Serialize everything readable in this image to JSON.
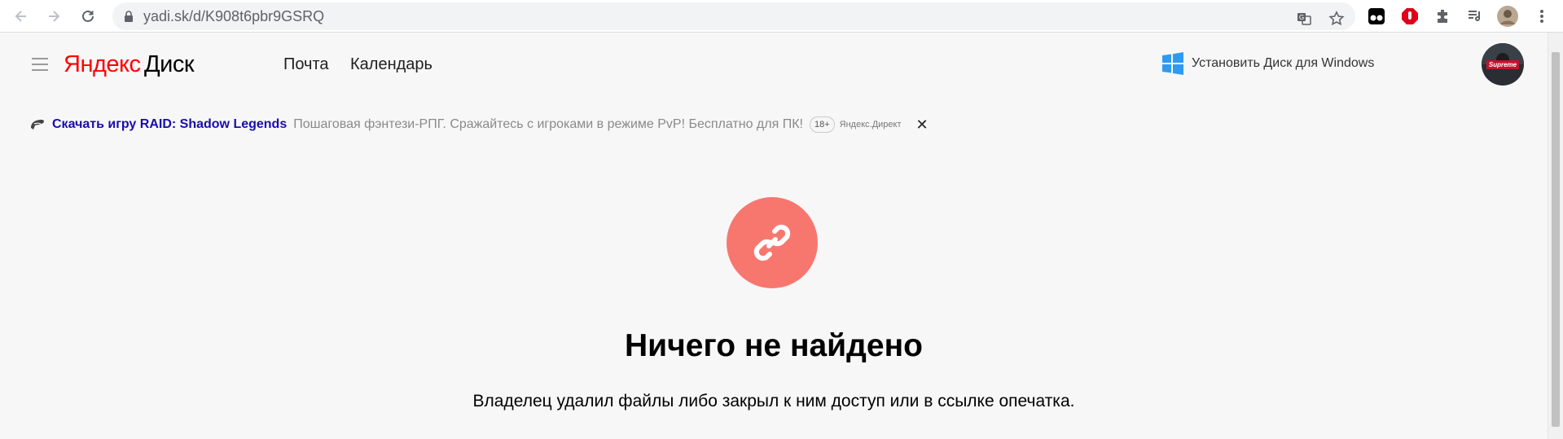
{
  "browser": {
    "url": "yadi.sk/d/K908t6pbr9GSRQ",
    "icons": [
      "back-icon",
      "forward-icon",
      "reload-icon",
      "lock-icon",
      "translate-icon",
      "star-icon",
      "tampermonkey-icon",
      "adblock-icon",
      "extensions-icon",
      "media-control-icon",
      "profile-avatar",
      "menu-icon"
    ]
  },
  "header": {
    "logo_text_ya": "Яндекс",
    "logo_text_disk": "Диск",
    "nav": [
      "Почта",
      "Календарь"
    ],
    "install_label": "Установить Диск для Windows",
    "avatar_text": "Supreme"
  },
  "ad": {
    "title": "Скачать игру RAID: Shadow Legends",
    "description": "Пошаговая фэнтези-РПГ. Сражайтесь с игроками в режиме PvP! Бесплатно для ПК!",
    "age": "18+",
    "source": "Яндекс.Директ",
    "close": "✕"
  },
  "main": {
    "title": "Ничего не найдено",
    "subtitle": "Владелец удалил файлы либо закрыл к ним доступ или в ссылке опечатка."
  },
  "colors": {
    "accent_red": "#f7776f",
    "logo_red": "#ff0000",
    "ad_link": "#1a0dab",
    "windows_blue": "#2f9bf0"
  }
}
